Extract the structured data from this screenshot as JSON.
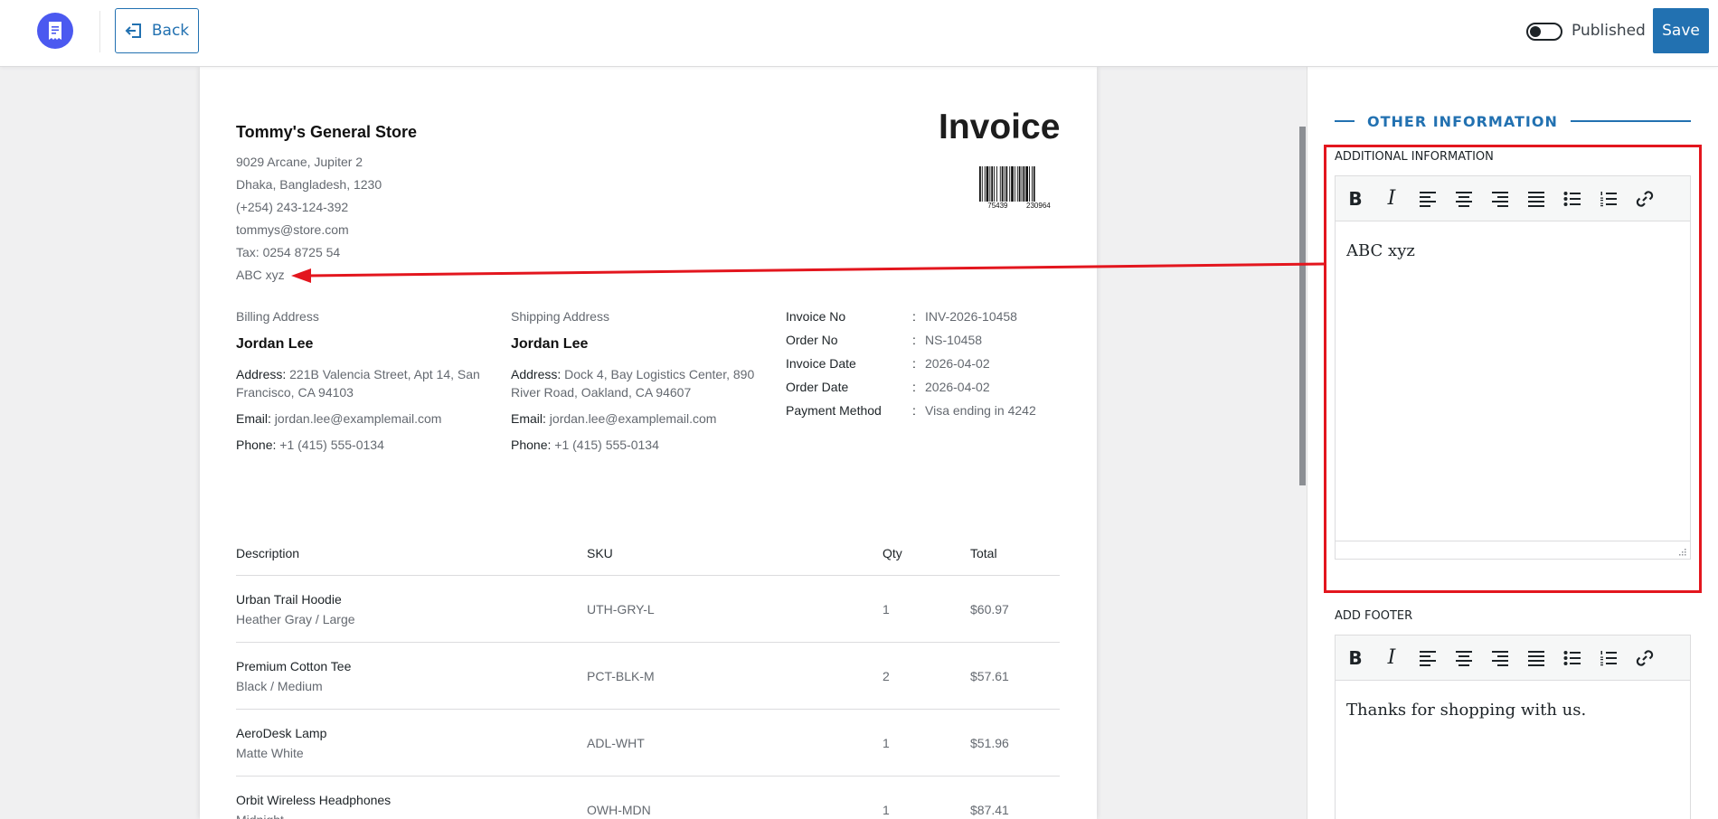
{
  "header": {
    "back_label": "Back",
    "published_label": "Published",
    "published_on": false,
    "save_label": "Save"
  },
  "invoice": {
    "store": {
      "name": "Tommy's General Store",
      "address1": "9029 Arcane, Jupiter 2",
      "address2": "Dhaka, Bangladesh, 1230",
      "phone": "(+254) 243-124-392",
      "email": "tommys@store.com",
      "tax": "Tax: 0254 8725 54",
      "extra": "ABC xyz"
    },
    "title": "Invoice",
    "barcode": {
      "left": "75439",
      "right": "230964"
    },
    "billing": {
      "label": "Billing Address",
      "name": "Jordan Lee",
      "address_key": "Address:",
      "address": "221B Valencia Street, Apt 14, San Francisco, CA 94103",
      "email_key": "Email:",
      "email": "jordan.lee@examplemail.com",
      "phone_key": "Phone:",
      "phone": "+1 (415) 555-0134"
    },
    "shipping": {
      "label": "Shipping Address",
      "name": "Jordan Lee",
      "address_key": "Address:",
      "address": "Dock 4, Bay Logistics Center, 890 River Road, Oakland, CA 94607",
      "email_key": "Email:",
      "email": "jordan.lee@examplemail.com",
      "phone_key": "Phone:",
      "phone": "+1 (415) 555-0134"
    },
    "meta": [
      {
        "key": "Invoice No",
        "value": "INV-2026-10458"
      },
      {
        "key": "Order No",
        "value": "NS-10458"
      },
      {
        "key": "Invoice Date",
        "value": "2026-04-02"
      },
      {
        "key": "Order Date",
        "value": "2026-04-02"
      },
      {
        "key": "Payment Method",
        "value": "Visa ending in 4242"
      }
    ],
    "meta_separator": ":",
    "columns": {
      "description": "Description",
      "sku": "SKU",
      "qty": "Qty",
      "total": "Total"
    },
    "items": [
      {
        "name": "Urban Trail Hoodie",
        "variant": "Heather Gray / Large",
        "sku": "UTH-GRY-L",
        "qty": "1",
        "total": "$60.97"
      },
      {
        "name": "Premium Cotton Tee",
        "variant": "Black / Medium",
        "sku": "PCT-BLK-M",
        "qty": "2",
        "total": "$57.61"
      },
      {
        "name": "AeroDesk Lamp",
        "variant": "Matte White",
        "sku": "ADL-WHT",
        "qty": "1",
        "total": "$51.96"
      },
      {
        "name": "Orbit Wireless Headphones",
        "variant": "Midnight",
        "sku": "OWH-MDN",
        "qty": "1",
        "total": "$87.41"
      }
    ]
  },
  "panel": {
    "section_title": "OTHER INFORMATION",
    "additional_label": "ADDITIONAL INFORMATION",
    "additional_value": "ABC xyz",
    "footer_label": "ADD FOOTER",
    "footer_value": "Thanks for shopping with us."
  },
  "colors": {
    "accent": "#2271b1",
    "logo": "#4b59f0",
    "annotation": "#e3161e"
  }
}
